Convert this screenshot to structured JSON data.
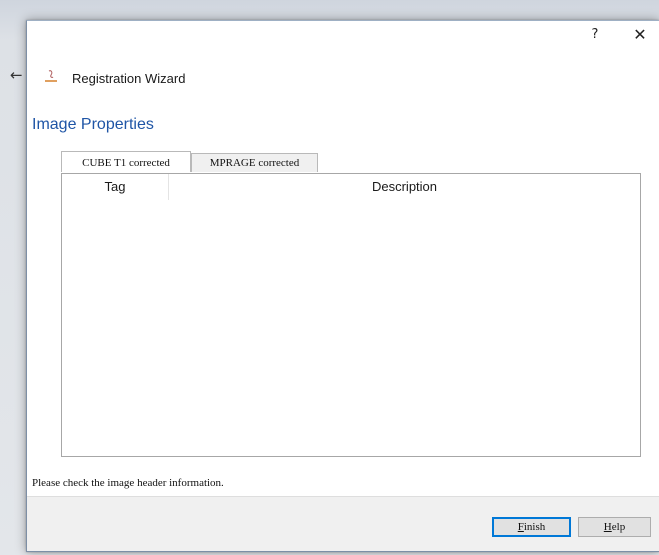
{
  "titlebar": {
    "help_label": "?",
    "close_label": "✕"
  },
  "wizard": {
    "back_label": "←",
    "title": "Registration Wizard"
  },
  "page": {
    "heading": "Image Properties"
  },
  "tabs": [
    {
      "label": "CUBE T1 corrected",
      "active": true
    },
    {
      "label": "MPRAGE corrected",
      "active": false
    }
  ],
  "table": {
    "columns": [
      "Tag",
      "Description"
    ],
    "rows": []
  },
  "status": {
    "message": "Please check the image header information."
  },
  "buttons": {
    "finish_first": "F",
    "finish_rest": "inish",
    "help_first": "H",
    "help_rest": "elp"
  },
  "colors": {
    "heading": "#1f55a6",
    "default_button_border": "#0078d7",
    "footer_bg": "#f0f0f0"
  }
}
